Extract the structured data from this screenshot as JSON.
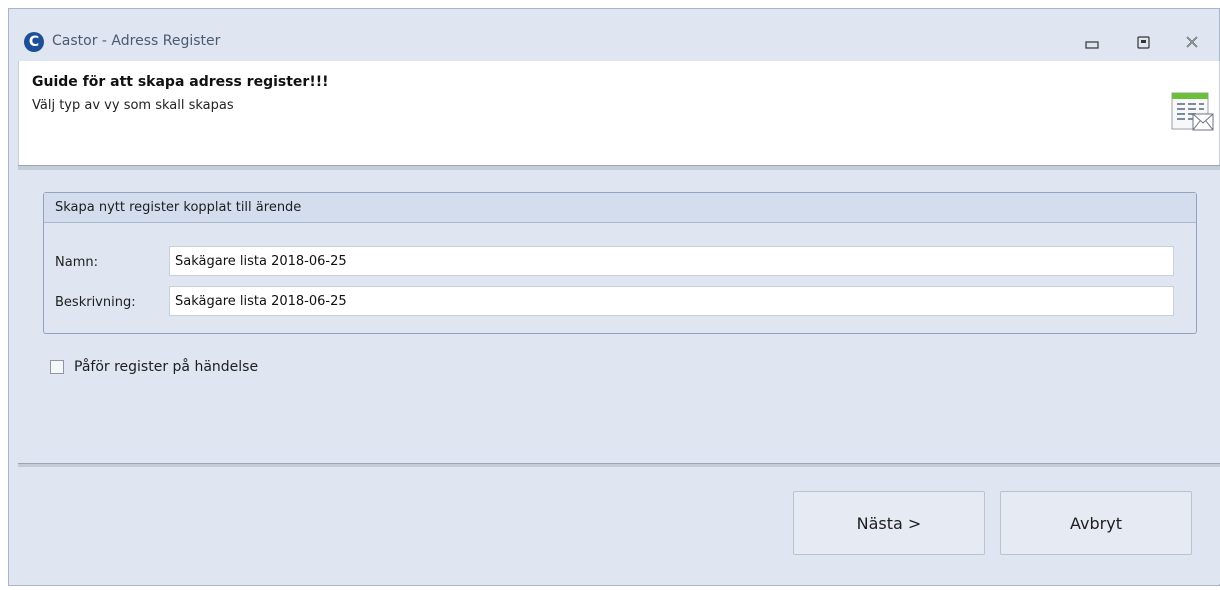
{
  "window": {
    "title": "Castor - Adress Register",
    "app_icon_letter": "C"
  },
  "header": {
    "title": "Guide för att skapa adress register!!!",
    "subtitle": "Välj typ av vy som skall skapas",
    "icon": "address-list-mail-icon"
  },
  "group": {
    "title": "Skapa nytt register kopplat till ärende",
    "name_label": "Namn:",
    "name_value": "Sakägare lista 2018-06-25",
    "description_label": "Beskrivning:",
    "description_value": "Sakägare lista 2018-06-25"
  },
  "checkbox": {
    "label": "Påför register på händelse",
    "checked": false
  },
  "buttons": {
    "next": "Nästa >",
    "cancel": "Avbryt"
  },
  "colors": {
    "background": "#dfe6f1",
    "accent": "#1d4f97"
  }
}
